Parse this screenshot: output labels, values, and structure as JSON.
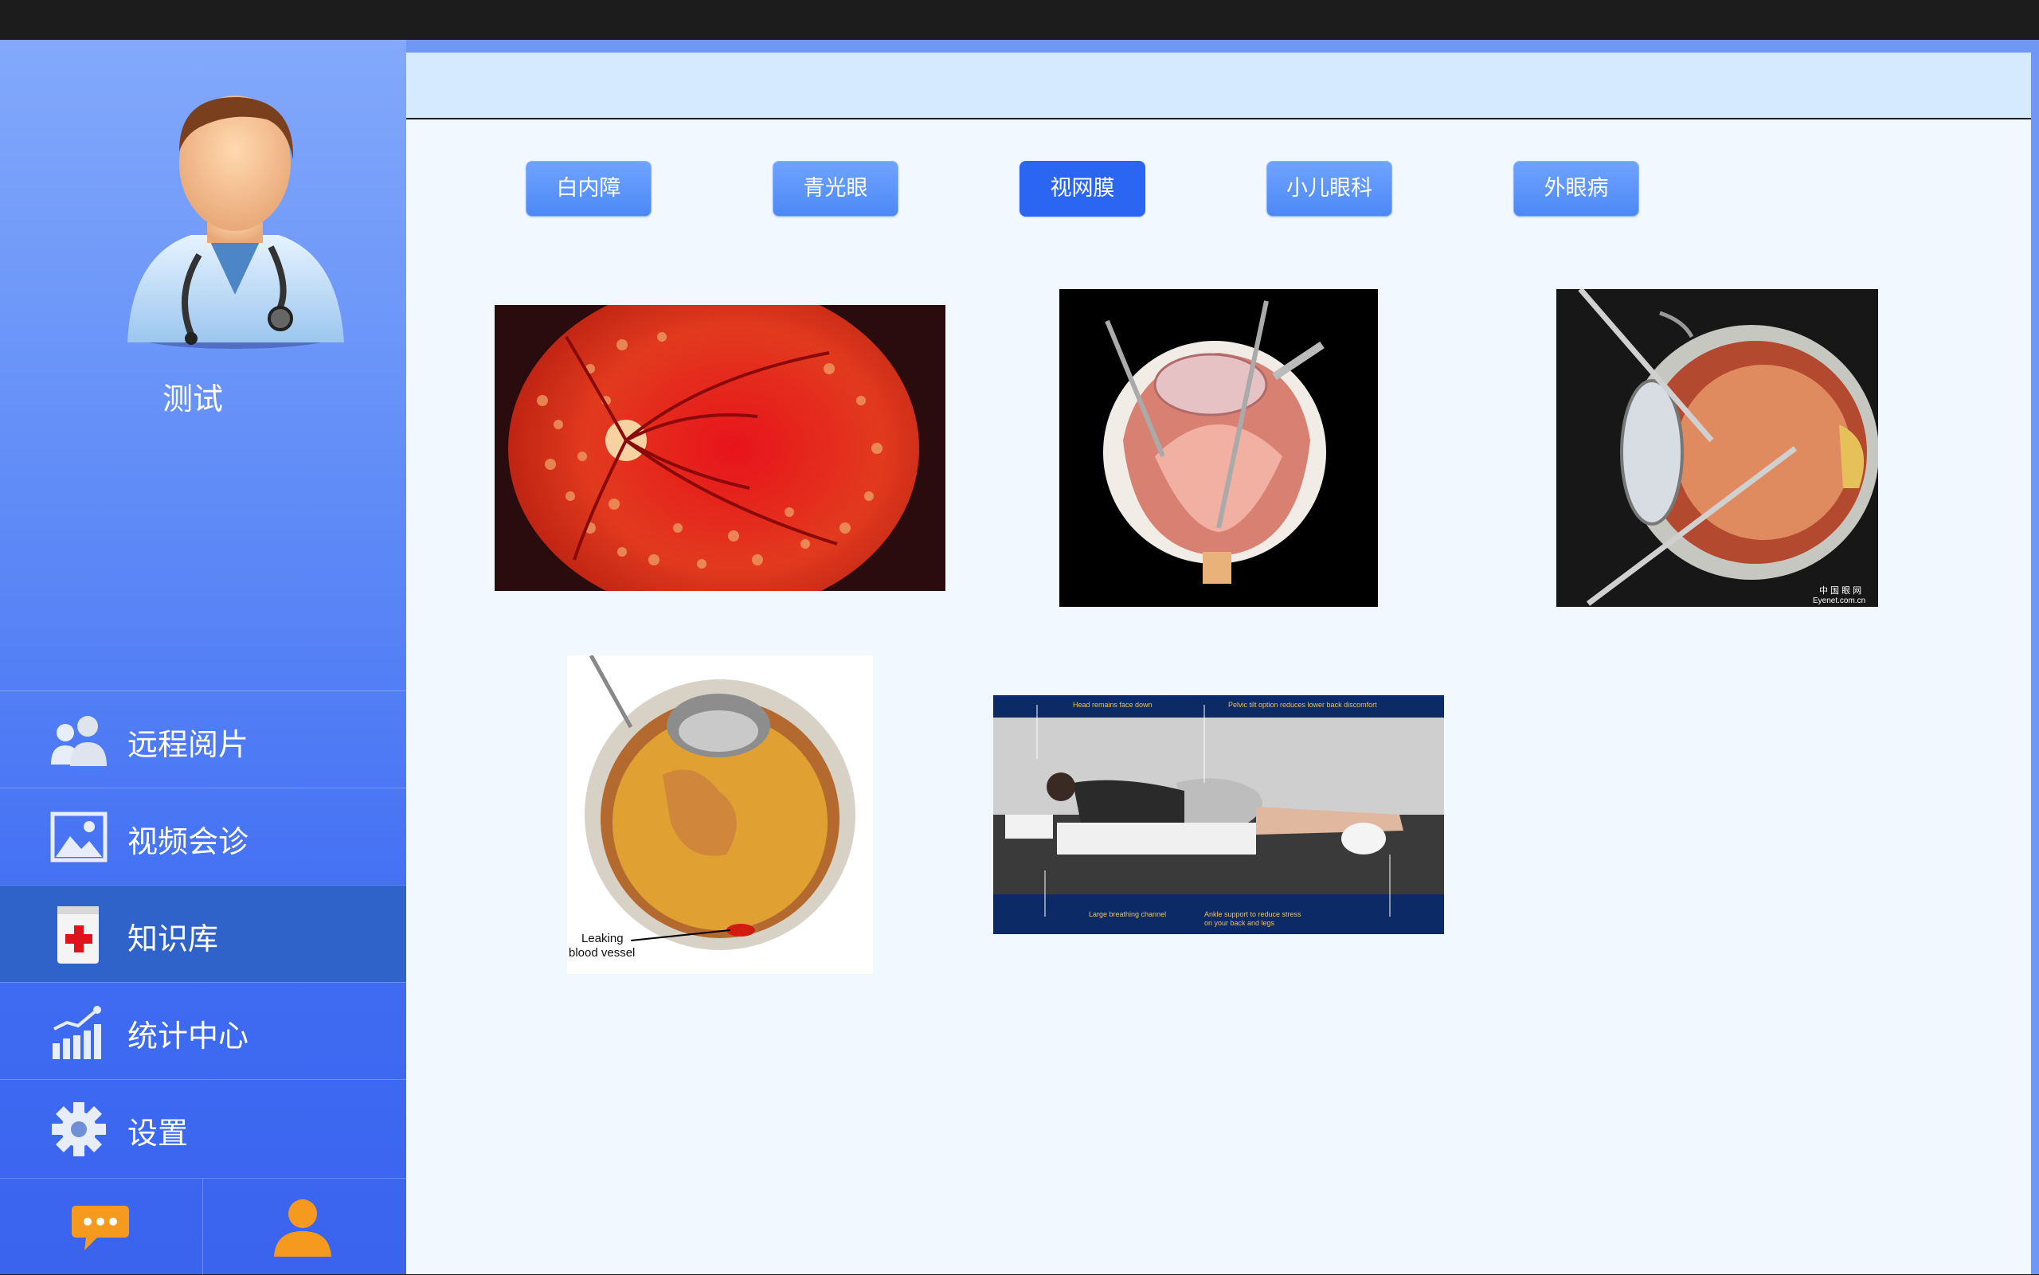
{
  "user": {
    "name": "测试"
  },
  "nav": {
    "items": [
      {
        "label": "远程阅片",
        "icon": "users-icon"
      },
      {
        "label": "视频会诊",
        "icon": "image-icon"
      },
      {
        "label": "知识库",
        "icon": "medical-book-icon",
        "active": true
      },
      {
        "label": "统计中心",
        "icon": "chart-icon"
      },
      {
        "label": "设置",
        "icon": "gear-icon"
      }
    ]
  },
  "bottom": {
    "left_icon": "chat-icon",
    "right_icon": "user-icon",
    "icon_color": "#f59a1f"
  },
  "tabs": [
    {
      "label": "白内障"
    },
    {
      "label": "青光眼"
    },
    {
      "label": "视网膜",
      "active": true
    },
    {
      "label": "小儿眼科"
    },
    {
      "label": "外眼病"
    }
  ],
  "images": {
    "img2_watermark_line1": "中 国 眼 网",
    "img2_watermark_line2": "Eyenet.com.cn",
    "img3_caption_line1": "Leaking",
    "img3_caption_line2": "blood vessel",
    "img4_label_top_left": "Head remains face down",
    "img4_label_top_right": "Pelvic tilt option reduces lower back discomfort",
    "img4_label_bottom_left": "Large breathing channel",
    "img4_label_bottom_right_1": "Ankle support to reduce stress",
    "img4_label_bottom_right_2": "on your back and legs"
  },
  "colors": {
    "active_nav": "#2f63c9",
    "tab": "#5a92f8",
    "tab_active": "#2a66f2"
  }
}
